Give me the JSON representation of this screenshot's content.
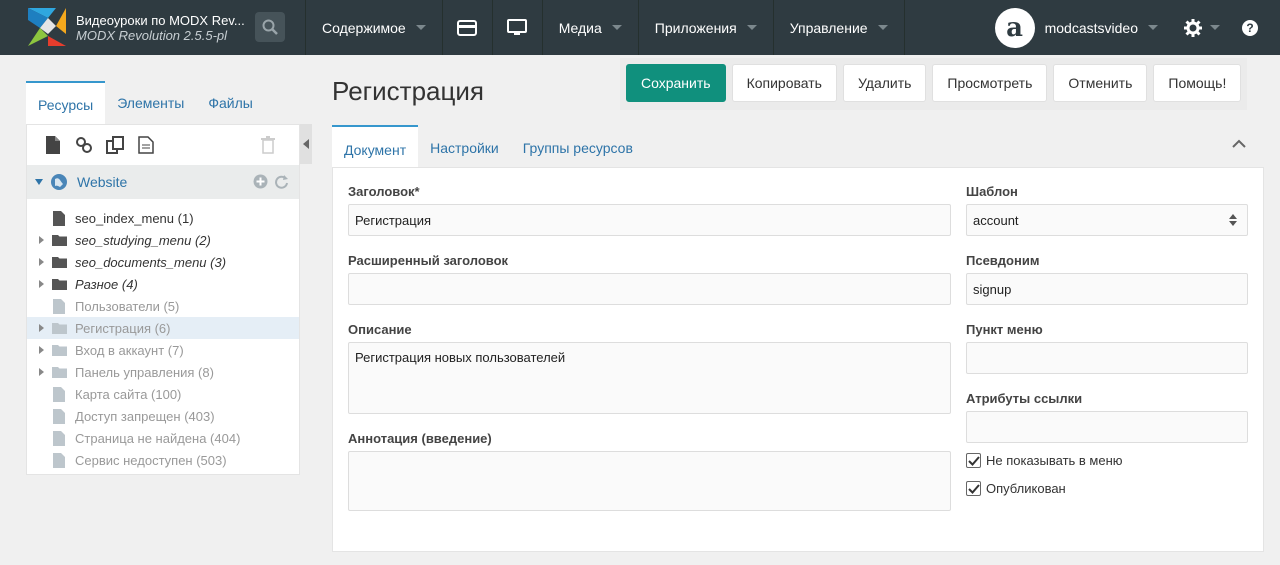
{
  "header": {
    "site_name": "Видеоуроки по MODX Rev...",
    "version": "MODX Revolution 2.5.5-pl",
    "nav": [
      {
        "label": "Содержимое"
      },
      {
        "icon": "credit-card-icon"
      },
      {
        "icon": "monitor-icon"
      },
      {
        "label": "Медиа"
      },
      {
        "label": "Приложения"
      },
      {
        "label": "Управление"
      }
    ],
    "username": "modcastsvideo",
    "avatar_letter": "a"
  },
  "left": {
    "tabs": [
      "Ресурсы",
      "Элементы",
      "Файлы"
    ],
    "root_label": "Website",
    "tree": [
      {
        "label": "seo_index_menu (1)",
        "type": "doc",
        "state": "pub",
        "expandable": false,
        "italic": false
      },
      {
        "label": "seo_studying_menu (2)",
        "type": "folder",
        "state": "pub",
        "expandable": true,
        "italic": true
      },
      {
        "label": "seo_documents_menu (3)",
        "type": "folder",
        "state": "pub",
        "expandable": true,
        "italic": true
      },
      {
        "label": "Разное (4)",
        "type": "folder",
        "state": "pub",
        "expandable": true,
        "italic": true
      },
      {
        "label": "Пользователи (5)",
        "type": "doc",
        "state": "unpub",
        "expandable": false,
        "italic": false
      },
      {
        "label": "Регистрация (6)",
        "type": "folder",
        "state": "unpub",
        "expandable": true,
        "italic": false,
        "selected": true
      },
      {
        "label": "Вход в аккаунт (7)",
        "type": "folder",
        "state": "unpub",
        "expandable": true,
        "italic": false
      },
      {
        "label": "Панель управления (8)",
        "type": "folder",
        "state": "unpub",
        "expandable": true,
        "italic": false
      },
      {
        "label": "Карта сайта (100)",
        "type": "doc",
        "state": "unpub",
        "expandable": false,
        "italic": false
      },
      {
        "label": "Доступ запрещен (403)",
        "type": "doc",
        "state": "unpub",
        "expandable": false,
        "italic": false
      },
      {
        "label": "Страница не найдена (404)",
        "type": "doc",
        "state": "unpub",
        "expandable": false,
        "italic": false
      },
      {
        "label": "Сервис недоступен (503)",
        "type": "doc",
        "state": "unpub",
        "expandable": false,
        "italic": false
      }
    ]
  },
  "main": {
    "title": "Регистрация",
    "actions": [
      "Сохранить",
      "Копировать",
      "Удалить",
      "Просмотреть",
      "Отменить",
      "Помощь!"
    ],
    "tabs": [
      "Документ",
      "Настройки",
      "Группы ресурсов"
    ],
    "fields": {
      "pagetitle_label": "Заголовок*",
      "pagetitle_value": "Регистрация",
      "longtitle_label": "Расширенный заголовок",
      "longtitle_value": "",
      "description_label": "Описание",
      "description_value": "Регистрация новых пользователей",
      "introtext_label": "Аннотация (введение)",
      "introtext_value": "",
      "template_label": "Шаблон",
      "template_value": "account",
      "alias_label": "Псевдоним",
      "alias_value": "signup",
      "menutitle_label": "Пункт меню",
      "menutitle_value": "",
      "link_attrs_label": "Атрибуты ссылки",
      "link_attrs_value": "",
      "hidemenu_label": "Не показывать в меню",
      "hidemenu_checked": true,
      "published_label": "Опубликован",
      "published_checked": true
    }
  }
}
